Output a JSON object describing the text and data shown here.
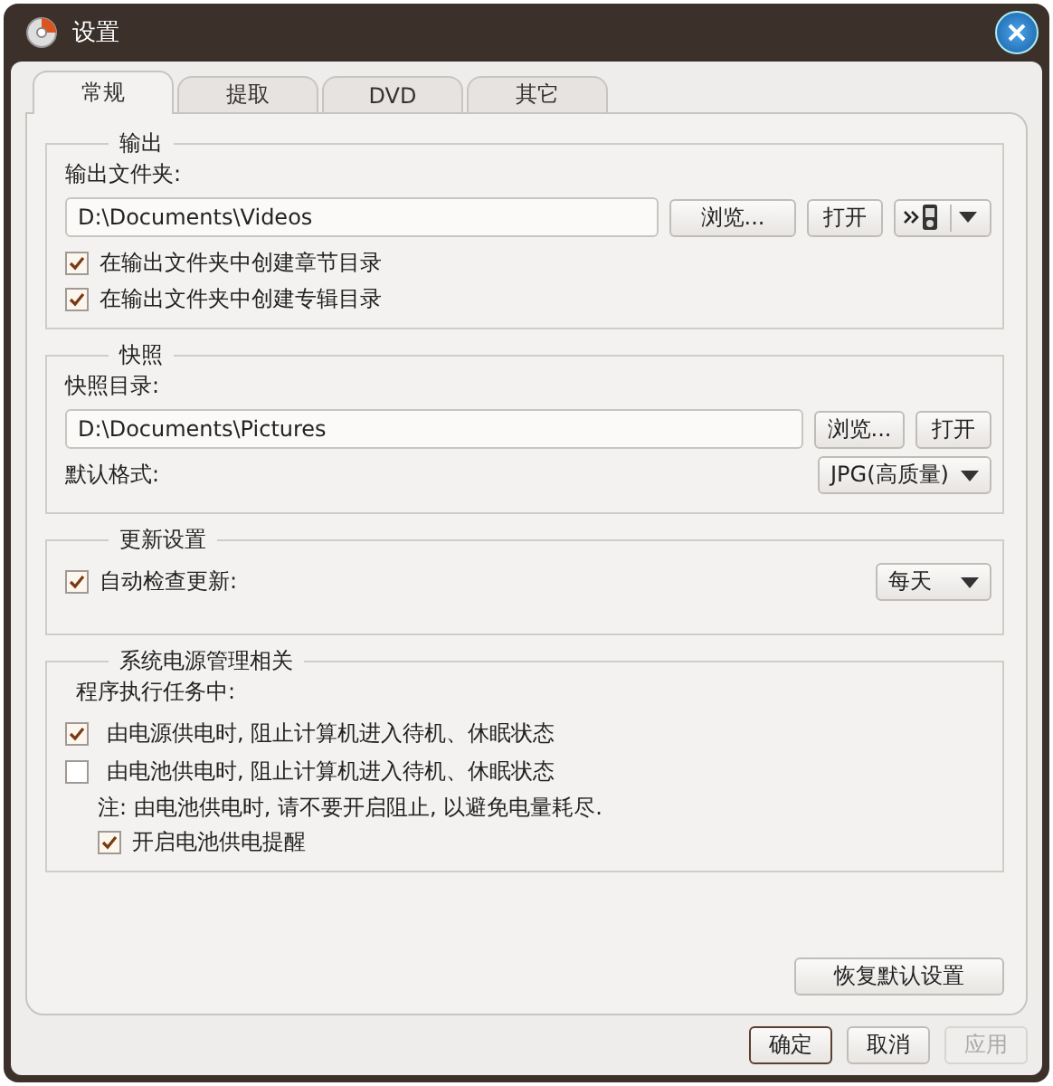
{
  "window": {
    "title": "设置"
  },
  "tabs": [
    {
      "label": "常规",
      "selected": true
    },
    {
      "label": "提取",
      "selected": false
    },
    {
      "label": "DVD",
      "selected": false
    },
    {
      "label": "其它",
      "selected": false
    }
  ],
  "output": {
    "title": "输出",
    "folder_label": "输出文件夹:",
    "folder_path": "D:\\Documents\\Videos",
    "browse": "浏览...",
    "open": "打开",
    "checkboxes": [
      {
        "label": "在输出文件夹中创建章节目录",
        "checked": true
      },
      {
        "label": "在输出文件夹中创建专辑目录",
        "checked": true
      }
    ]
  },
  "snapshot": {
    "title": "快照",
    "folder_label": "快照目录:",
    "folder_path": "D:\\Documents\\Pictures",
    "browse": "浏览...",
    "open": "打开",
    "format_label": "默认格式:",
    "format_value": "JPG(高质量)"
  },
  "update": {
    "title": "更新设置",
    "auto_check": {
      "label": "自动检查更新:",
      "checked": true
    },
    "frequency": "每天"
  },
  "power": {
    "title": "系统电源管理相关",
    "intro": "程序执行任务中:",
    "options": [
      {
        "label": "由电源供电时, 阻止计算机进入待机、休眠状态",
        "checked": true
      },
      {
        "label": "由电池供电时, 阻止计算机进入待机、休眠状态",
        "checked": false
      }
    ],
    "note": "注: 由电池供电时, 请不要开启阻止, 以避免电量耗尽.",
    "reminder": {
      "label": "开启电池供电提醒",
      "checked": true
    }
  },
  "restore_button": "恢复默认设置",
  "buttons": [
    {
      "label": "确定",
      "default": true,
      "disabled": false
    },
    {
      "label": "取消",
      "default": false,
      "disabled": false
    },
    {
      "label": "应用",
      "default": false,
      "disabled": true
    }
  ]
}
